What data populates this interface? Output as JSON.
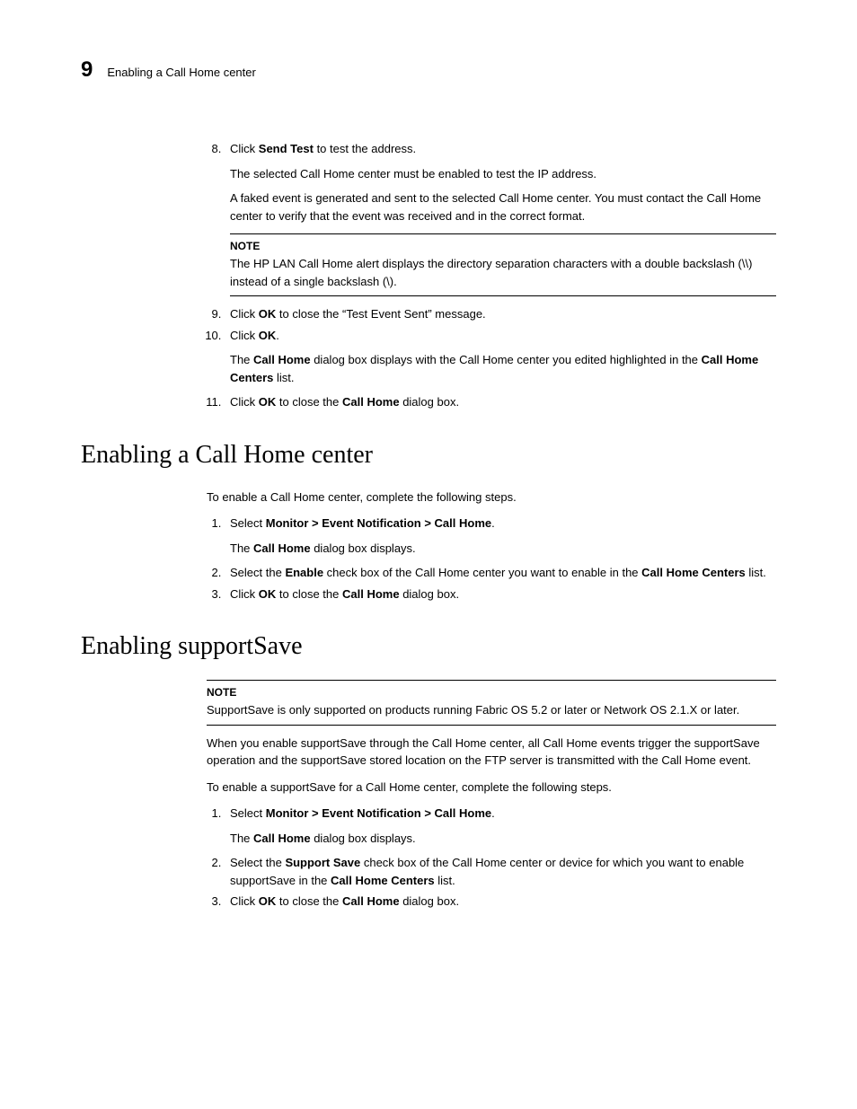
{
  "header": {
    "chapter": "9",
    "title": "Enabling a Call Home center"
  },
  "section1": {
    "step8_prefix": "Click ",
    "step8_bold": "Send Test",
    "step8_suffix": " to test the address.",
    "step8_sub1": "The selected Call Home center must be enabled to test the IP address.",
    "step8_sub2": "A faked event is generated and sent to the selected Call Home center. You must contact the Call Home center to verify that the event was received and in the correct format.",
    "note1_label": "NOTE",
    "note1_text": "The HP LAN Call Home alert displays the directory separation characters with a double backslash (\\\\) instead of a single backslash (\\).",
    "step9_prefix": "Click ",
    "step9_bold": "OK",
    "step9_suffix": " to close the “Test Event Sent” message.",
    "step10_prefix": "Click ",
    "step10_bold": "OK",
    "step10_suffix": ".",
    "step10_sub_p1": "The ",
    "step10_sub_b1": "Call Home",
    "step10_sub_p2": " dialog box displays with the Call Home center you edited highlighted in the ",
    "step10_sub_b2": "Call Home Centers",
    "step10_sub_p3": " list.",
    "step11_prefix": "Click ",
    "step11_bold": "OK",
    "step11_mid": " to close the ",
    "step11_bold2": "Call Home",
    "step11_suffix": " dialog box."
  },
  "section2": {
    "heading": "Enabling a Call Home center",
    "intro": "To enable a Call Home center, complete the following steps.",
    "step1_prefix": "Select ",
    "step1_bold": "Monitor > Event Notification > Call Home",
    "step1_suffix": ".",
    "step1_sub_p1": "The ",
    "step1_sub_b1": "Call Home",
    "step1_sub_p2": " dialog box displays.",
    "step2_p1": "Select the ",
    "step2_b1": "Enable",
    "step2_p2": " check box of the Call Home center you want to enable in the ",
    "step2_b2": "Call Home Centers",
    "step2_p3": " list.",
    "step3_prefix": "Click ",
    "step3_bold": "OK",
    "step3_mid": " to close the ",
    "step3_bold2": "Call Home",
    "step3_suffix": " dialog box."
  },
  "section3": {
    "heading": "Enabling supportSave",
    "note_label": "NOTE",
    "note_text": "SupportSave is only supported on products running Fabric OS 5.2 or later or Network OS 2.1.X or later.",
    "para1": "When you enable supportSave through the Call Home center, all Call Home events trigger the supportSave operation and the supportSave stored location on the FTP server is transmitted with the Call Home event.",
    "para2": "To enable a supportSave for a Call Home center, complete the following steps.",
    "step1_prefix": "Select ",
    "step1_bold": "Monitor > Event Notification > Call Home",
    "step1_suffix": ".",
    "step1_sub_p1": "The ",
    "step1_sub_b1": "Call Home",
    "step1_sub_p2": " dialog box displays.",
    "step2_p1": "Select the ",
    "step2_b1": "Support Save",
    "step2_p2": " check box of the Call Home center or device for which you want to enable supportSave in the ",
    "step2_b2": "Call Home Centers",
    "step2_p3": " list.",
    "step3_prefix": "Click ",
    "step3_bold": "OK",
    "step3_mid": " to close the ",
    "step3_bold2": "Call Home",
    "step3_suffix": " dialog box."
  }
}
